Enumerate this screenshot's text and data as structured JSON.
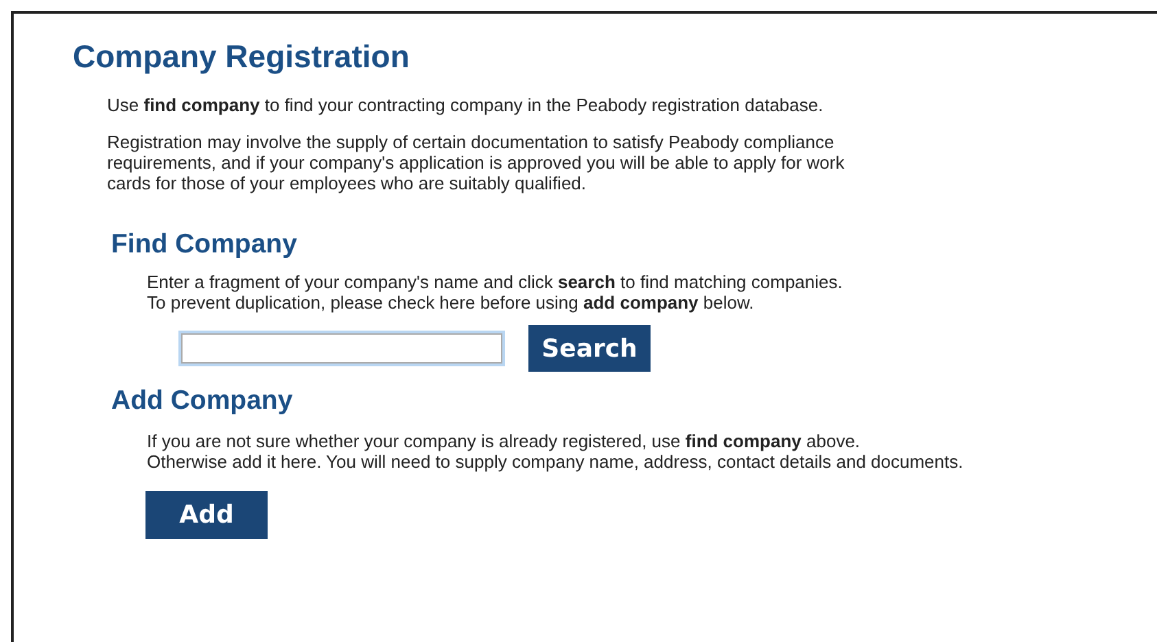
{
  "title": "Company Registration",
  "intro": [
    "Use **find company** to find your contracting company in the Peabody registration database.",
    "Registration may involve the supply of certain documentation to satisfy Peabody compliance requirements, and if your company's application is approved you will be able to apply for work cards for those of your employees who are suitably qualified."
  ],
  "find_company": {
    "heading": "Find Company",
    "lines": [
      "Enter a fragment of your company's name and click **search** to find matching companies.",
      "To prevent duplication, please check here before using **add company** below."
    ],
    "search_field": {
      "focused": true
    },
    "button": "Search"
  },
  "add_company": {
    "heading": "Add Company",
    "lines": [
      "If you are not sure whether your company is already registered, use **find company** above.",
      "Otherwise add it here. You will need to supply company name, address, contact details and documents."
    ],
    "button": "Add"
  }
}
